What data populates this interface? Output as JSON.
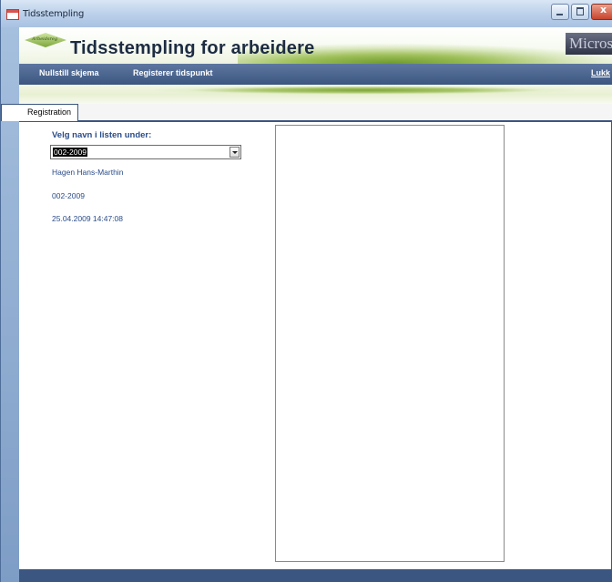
{
  "window": {
    "title": "Tidsstempling"
  },
  "banner": {
    "title": "Tidsstempling for arbeidere",
    "logo_text": "Arbeidsreg",
    "brand_text": "Microsoft"
  },
  "menu": {
    "reset_label": "Nullstill skjema",
    "register_label": "Registerer tidspunkt",
    "close_label": "Lukk"
  },
  "tabs": [
    {
      "label": "Registration"
    }
  ],
  "form": {
    "prompt": "Velg navn i listen under:",
    "selected_value": "002-2009",
    "name": "Hagen Hans-Marthin",
    "id": "002-2009",
    "timestamp": "25.04.2009 14:47:08"
  },
  "colors": {
    "menubar": "#3b5680",
    "label_text": "#2a4c89",
    "accent_green": "#7ea53a"
  },
  "icons": {
    "app": "app-icon",
    "minimize": "minimize-icon",
    "maximize": "maximize-icon",
    "close": "close-icon",
    "dropdown": "chevron-down-icon"
  }
}
